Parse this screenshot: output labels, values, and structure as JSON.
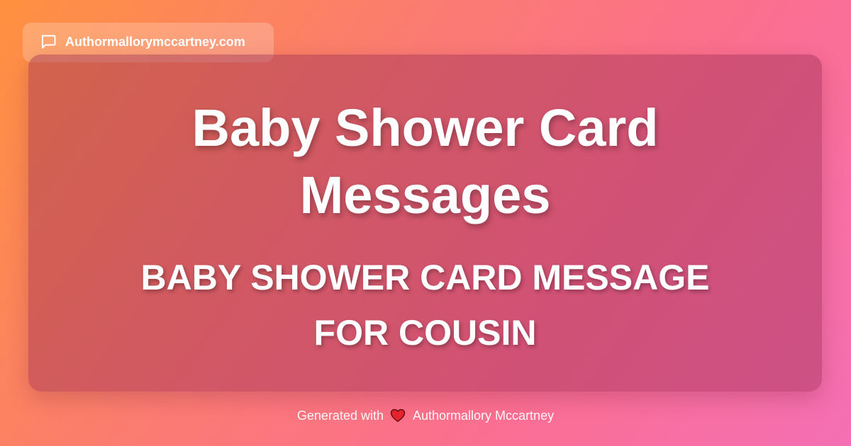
{
  "badge": {
    "icon": "chat-bubble-icon",
    "site": "Authormallorymccartney.com"
  },
  "card": {
    "title_line1": "Baby Shower Card",
    "title_line2": "Messages",
    "subtitle_line1": "BABY SHOWER CARD MESSAGE",
    "subtitle_line2": "FOR COUSIN"
  },
  "footer": {
    "prefix": "Generated with",
    "icon": "heart-icon",
    "author": "Authormallory Mccartney"
  },
  "colors": {
    "gradient_start": "#ff9140",
    "gradient_mid": "#fb6f8e",
    "gradient_end": "#f46fb4",
    "heart": "#e8202a"
  }
}
